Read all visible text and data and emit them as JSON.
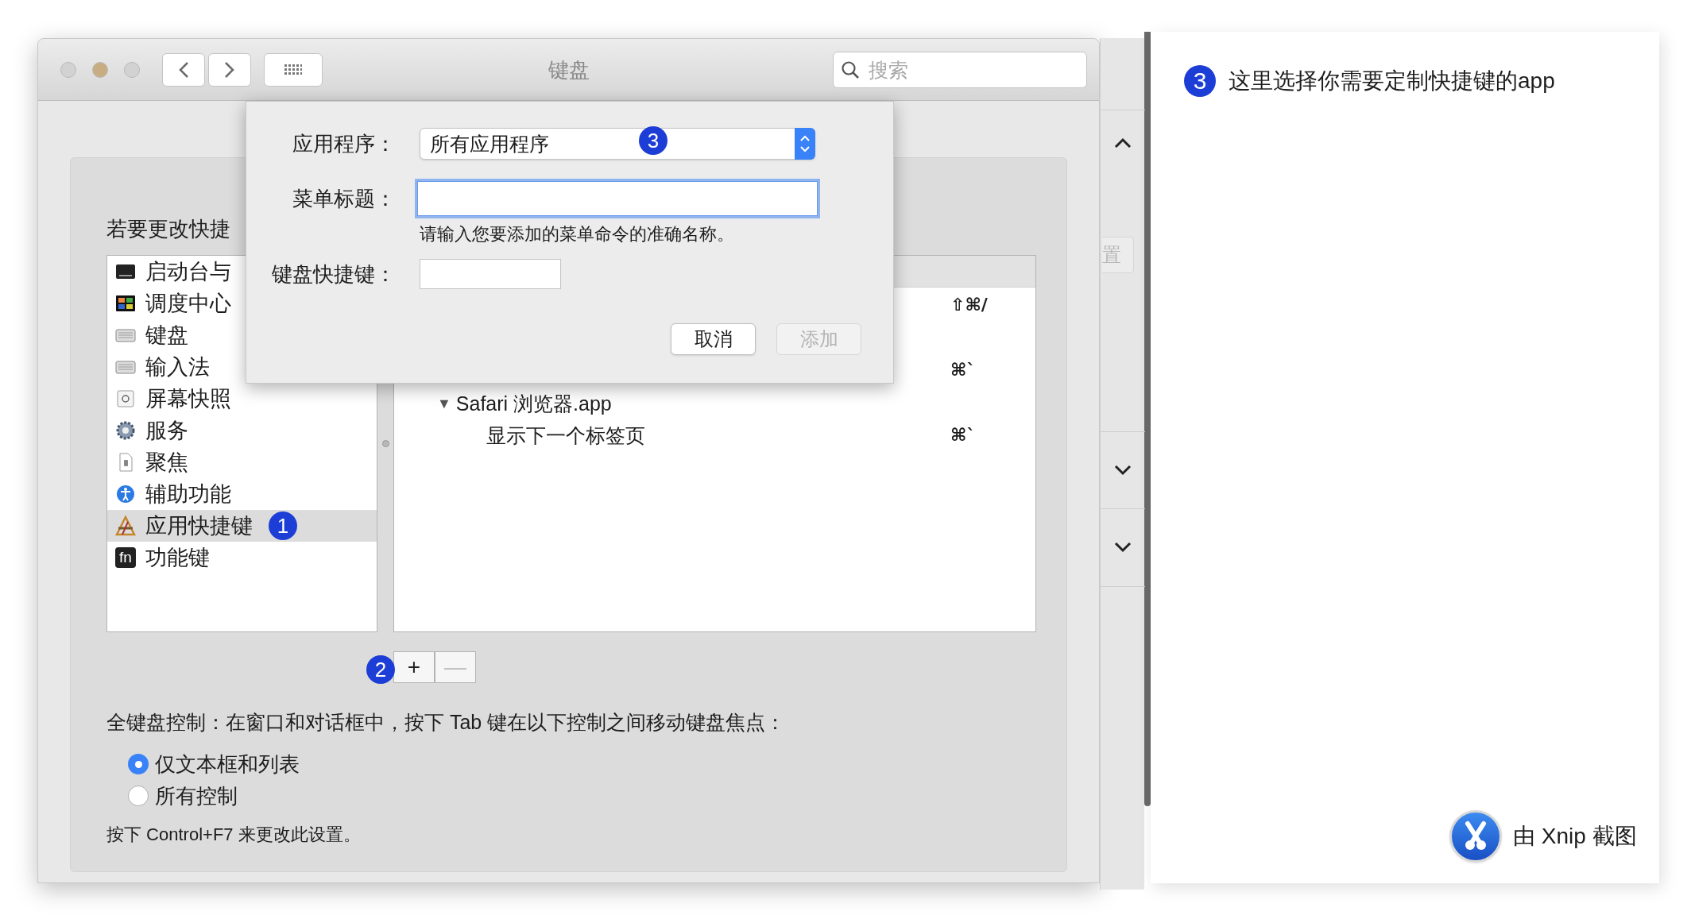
{
  "window": {
    "title": "键盘",
    "search": {
      "placeholder": "搜索"
    }
  },
  "background_window": {
    "button_fragment": "置"
  },
  "instruction": "若要更改快捷",
  "categories": [
    {
      "label": "启动台与",
      "selected": false
    },
    {
      "label": "调度中心",
      "selected": false
    },
    {
      "label": "键盘",
      "selected": false
    },
    {
      "label": "输入法",
      "selected": false
    },
    {
      "label": "屏幕快照",
      "selected": false
    },
    {
      "label": "服务",
      "selected": false
    },
    {
      "label": "聚焦",
      "selected": false
    },
    {
      "label": "辅助功能",
      "selected": false
    },
    {
      "label": "应用快捷键",
      "selected": true,
      "badge": "1"
    },
    {
      "label": "功能键",
      "selected": false,
      "icon_text": "fn"
    }
  ],
  "shortcuts": [
    {
      "key": "⇧⌘/"
    },
    {
      "key": "⌘`"
    },
    {
      "label": "Safari 浏览器.app",
      "toggle": "▼",
      "expanded": true,
      "children": [
        {
          "label": "显示下一个标签页",
          "key": "⌘`"
        }
      ]
    }
  ],
  "list_buttons": {
    "badge": "2",
    "items": [
      {
        "label": "+",
        "disabled": false
      },
      {
        "label": "—",
        "disabled": true
      }
    ]
  },
  "full_keyboard_access": {
    "text": "全键盘控制：在窗口和对话框中，按下 Tab 键在以下控制之间移动键盘焦点：",
    "options": [
      {
        "label": "仅文本框和列表",
        "selected": true
      },
      {
        "label": "所有控制",
        "selected": false
      }
    ],
    "note": "按下 Control+F7 来更改此设置。"
  },
  "dialog": {
    "application": {
      "label": "应用程序：",
      "value": "所有应用程序",
      "badge": "3"
    },
    "menu_title": {
      "label": "菜单标题：",
      "focused": true,
      "hint": "请输入您要添加的菜单命令的准确名称。"
    },
    "shortcut": {
      "label": "键盘快捷键："
    },
    "buttons": [
      {
        "label": "取消",
        "disabled": false
      },
      {
        "label": "添加",
        "disabled": true
      }
    ]
  },
  "annotation": {
    "badge": "3",
    "text": "这里选择你需要定制快捷键的app"
  },
  "credit": "由 Xnip 截图"
}
